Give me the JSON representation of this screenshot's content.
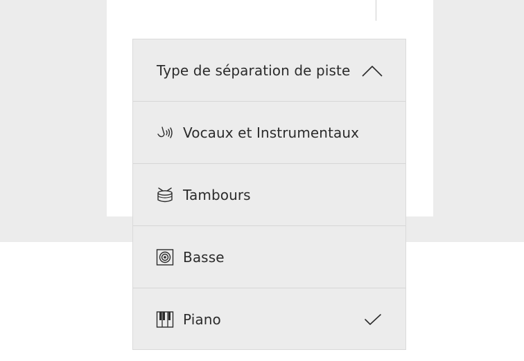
{
  "dropdown": {
    "title": "Type de séparation de piste",
    "title_icon": "chevron-up-icon",
    "items": [
      {
        "label": "Vocaux et Instrumentaux",
        "icon": "vocal-icon",
        "selected": false
      },
      {
        "label": "Tambours",
        "icon": "drum-icon",
        "selected": false
      },
      {
        "label": "Basse",
        "icon": "speaker-icon",
        "selected": false
      },
      {
        "label": "Piano",
        "icon": "piano-icon",
        "selected": true
      }
    ],
    "selected_indicator_icon": "checkmark-icon"
  }
}
